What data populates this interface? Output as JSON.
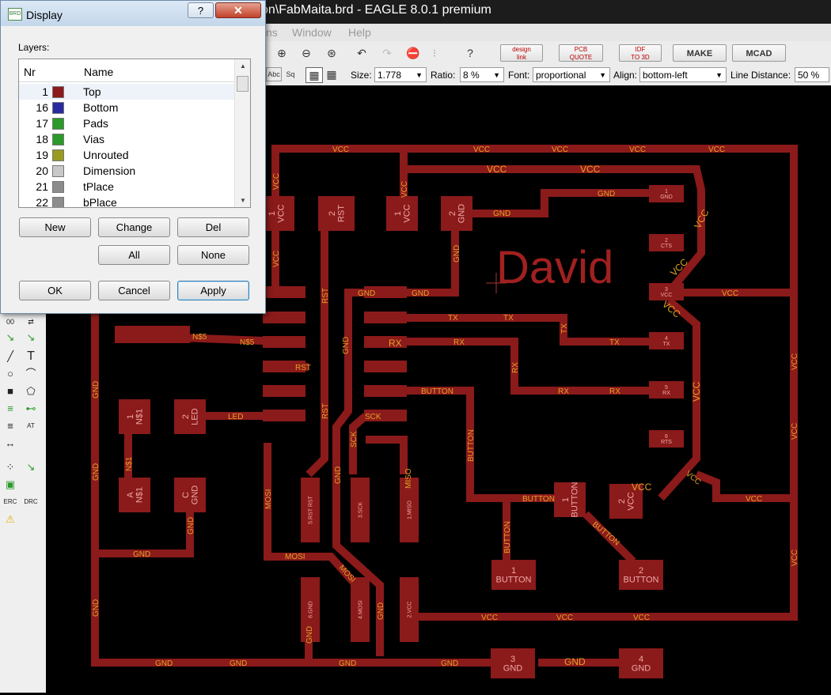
{
  "window": {
    "title": "ón\\FabMaita.brd - EAGLE 8.0.1 premium"
  },
  "menu": [
    "ns",
    "Window",
    "Help"
  ],
  "toolbar1": {
    "buttons": [
      {
        "label": "design\nlink"
      },
      {
        "label": "PCB\nQUOTE"
      },
      {
        "label": "IDF\nTO 3D"
      },
      {
        "label": "MAKE"
      },
      {
        "label": "MCAD"
      }
    ]
  },
  "toolbar2": {
    "size_label": "Size:",
    "size_value": "1.778",
    "ratio_label": "Ratio:",
    "ratio_value": "8 %",
    "font_label": "Font:",
    "font_value": "proportional",
    "align_label": "Align:",
    "align_value": "bottom-left",
    "linedist_label": "Line Distance:",
    "linedist_value": "50 %"
  },
  "dialog": {
    "title": "Display",
    "help": "?",
    "close": "✕",
    "layers_label": "Layers:",
    "col_nr": "Nr",
    "col_name": "Name",
    "layers": [
      {
        "nr": "1",
        "name": "Top",
        "color": "#8b1a1a"
      },
      {
        "nr": "16",
        "name": "Bottom",
        "color": "#2a2aa0"
      },
      {
        "nr": "17",
        "name": "Pads",
        "color": "#2a9a2a"
      },
      {
        "nr": "18",
        "name": "Vias",
        "color": "#2a9a2a"
      },
      {
        "nr": "19",
        "name": "Unrouted",
        "color": "#9a9a20"
      },
      {
        "nr": "20",
        "name": "Dimension",
        "color": "#c8c8c8"
      },
      {
        "nr": "21",
        "name": "tPlace",
        "color": "#8c8c8c"
      },
      {
        "nr": "22",
        "name": "bPlace",
        "color": "#8c8c8c"
      }
    ],
    "btn_new": "New",
    "btn_change": "Change",
    "btn_del": "Del",
    "btn_all": "All",
    "btn_none": "None",
    "btn_ok": "OK",
    "btn_cancel": "Cancel",
    "btn_apply": "Apply"
  },
  "board": {
    "name_text": "David",
    "colors": {
      "copper": "#8b1a1a",
      "signal_label": "#e3a326",
      "pad_label": "#f0a8a8"
    },
    "labels": {
      "vcc": "VCC",
      "gnd": "GND",
      "rst": "RST",
      "tx": "TX",
      "rx": "RX",
      "button": "BUTTON",
      "sck": "SCK",
      "miso": "MISO",
      "mosi": "MOSI",
      "led": "LED",
      "ns5": "N$5",
      "ns1": "N$1"
    },
    "pads": {
      "p1vcc": "1\nVCC",
      "p2rst": "2\nRST",
      "p1vcc2": "1\nVCC",
      "p2gnd": "2\nGND",
      "ftdi1": "1\nGND",
      "ftdi2": "2\nCTS",
      "ftdi3": "3\nVCC",
      "ftdi4": "4\nTX",
      "ftdi5": "5\nRX",
      "ftdi6": "6\nRTS",
      "r1": "1\nN$1",
      "led2": "2\nLED",
      "ledA": "A\nN$1",
      "ledC": "C\nGND",
      "isp5": "5.RST RST",
      "isp3": "3.SCK",
      "isp1": "1.MISO",
      "isp6": "6.GND",
      "isp4": "4.MOSI",
      "isp2": "2.VCC",
      "btn1": "1\nBUTTON",
      "cap2": "2\nVCC",
      "sw1": "1\nBUTTON",
      "sw2": "2\nBUTTON",
      "g3": "3\nGND",
      "g4": "4\nGND"
    }
  }
}
